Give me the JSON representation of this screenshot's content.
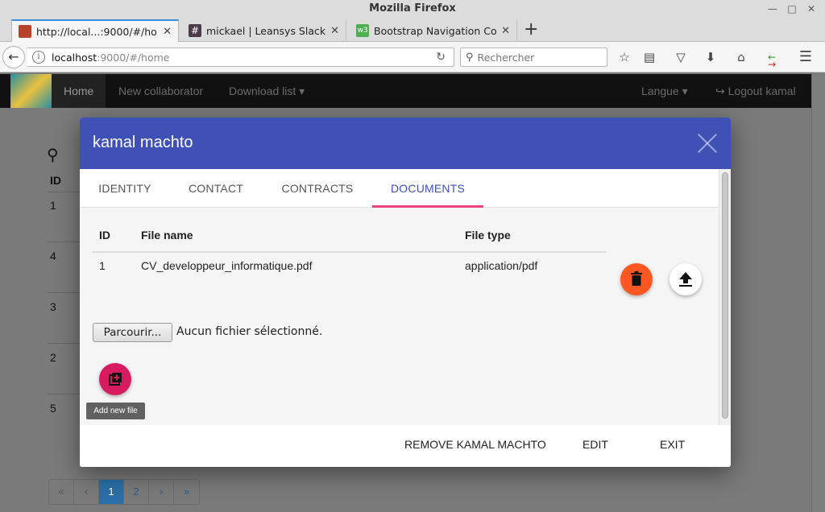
{
  "window": {
    "title": "Mozilla Firefox"
  },
  "tabs": [
    {
      "label": "http://local...:9000/#/home",
      "active": true
    },
    {
      "label": "mickael | Leansys Slack",
      "active": false
    },
    {
      "label": "Bootstrap Navigation Co...",
      "active": false
    }
  ],
  "urlbar": {
    "host": "localhost",
    "path": ":9000/#/home"
  },
  "search": {
    "placeholder": "Rechercher"
  },
  "app_nav": {
    "home": "Home",
    "new_collaborator": "New collaborator",
    "download_list": "Download list",
    "langue": "Langue",
    "logout": "Logout kamal"
  },
  "background_table": {
    "header": "ID",
    "rows": [
      "1",
      "4",
      "3",
      "2",
      "5"
    ]
  },
  "pagination": [
    "«",
    "‹",
    "1",
    "2",
    "›",
    "»"
  ],
  "modal": {
    "title": "kamal machto",
    "tabs": [
      "IDENTITY",
      "CONTACT",
      "CONTRACTS",
      "DOCUMENTS"
    ],
    "active_tab": "DOCUMENTS",
    "documents": {
      "columns": [
        "ID",
        "File name",
        "File type"
      ],
      "rows": [
        {
          "id": "1",
          "file_name": "CV_developpeur_informatique.pdf",
          "file_type": "application/pdf"
        }
      ]
    },
    "file_input": {
      "button": "Parcourir...",
      "status": "Aucun fichier sélectionné."
    },
    "add_file_tooltip": "Add new file",
    "footer": {
      "remove": "REMOVE KAMAL MACHTO",
      "edit": "EDIT",
      "exit": "EXIT"
    }
  },
  "colors": {
    "modal_header": "#3f51b5",
    "tab_ink": "#ec407a",
    "delete_fab": "#ff5722",
    "add_fab": "#d81b60"
  }
}
